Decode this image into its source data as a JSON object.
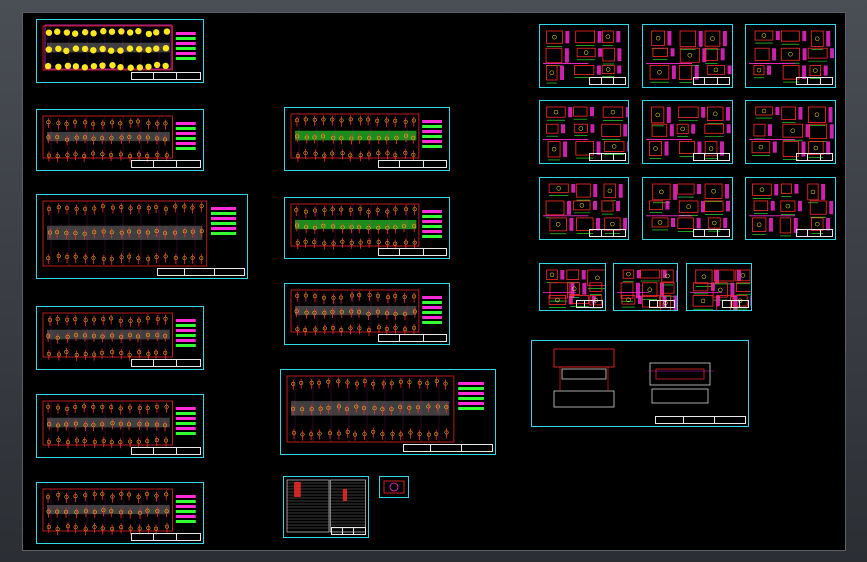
{
  "app": {
    "view": "cad-model-space"
  },
  "colors": {
    "background": "#000000",
    "frame": "#2fd7e8",
    "title_block": "#e8e8e8",
    "geometry_red": "#ff2a2a",
    "geometry_magenta": "#ff2bd6",
    "geometry_green": "#33ff33",
    "geometry_yellow": "#ffe81f",
    "geometry_white": "#f0f0f0"
  },
  "sheets": [
    {
      "id": "s01",
      "type": "strip-layout-yellow"
    },
    {
      "id": "s02",
      "type": "plate-layout"
    },
    {
      "id": "s03",
      "type": "plate-layout-large"
    },
    {
      "id": "s04",
      "type": "plate-layout"
    },
    {
      "id": "s05",
      "type": "plate-layout"
    },
    {
      "id": "s06",
      "type": "plate-layout"
    },
    {
      "id": "s07",
      "type": "plate-layout-green"
    },
    {
      "id": "s08",
      "type": "plate-layout-green"
    },
    {
      "id": "s09",
      "type": "plate-layout"
    },
    {
      "id": "s10",
      "type": "plate-layout-large"
    },
    {
      "id": "s11",
      "type": "bom-table"
    },
    {
      "id": "s12",
      "type": "small-detail"
    },
    {
      "id": "s13",
      "type": "part-details"
    },
    {
      "id": "s14",
      "type": "part-details"
    },
    {
      "id": "s15",
      "type": "part-details"
    },
    {
      "id": "s16",
      "type": "part-details"
    },
    {
      "id": "s17",
      "type": "part-details"
    },
    {
      "id": "s18",
      "type": "part-details"
    },
    {
      "id": "s19",
      "type": "part-details"
    },
    {
      "id": "s20",
      "type": "part-details"
    },
    {
      "id": "s21",
      "type": "part-details"
    },
    {
      "id": "s22",
      "type": "part-details-small"
    },
    {
      "id": "s23",
      "type": "part-details-small"
    },
    {
      "id": "s24",
      "type": "part-details-small"
    },
    {
      "id": "s25",
      "type": "assembly-section"
    }
  ]
}
